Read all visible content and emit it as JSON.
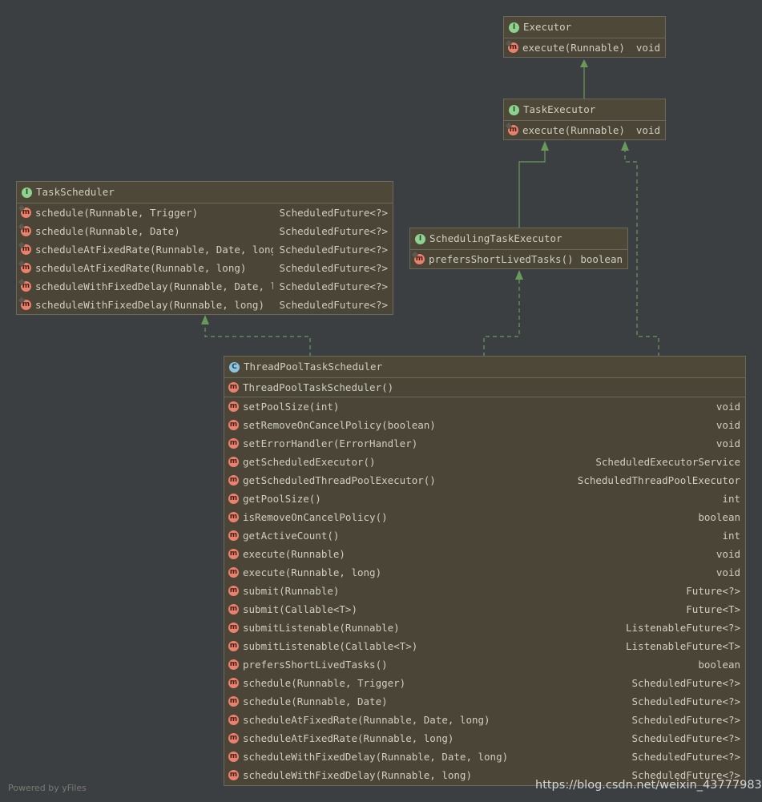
{
  "classes": {
    "executor": {
      "name": "Executor",
      "kind": "I",
      "methods": [
        {
          "name": "execute(Runnable)",
          "ret": "void"
        }
      ]
    },
    "task_executor": {
      "name": "TaskExecutor",
      "kind": "I",
      "methods": [
        {
          "name": "execute(Runnable)",
          "ret": "void"
        }
      ]
    },
    "scheduling_task_executor": {
      "name": "SchedulingTaskExecutor",
      "kind": "I",
      "methods": [
        {
          "name": "prefersShortLivedTasks()",
          "ret": "boolean"
        }
      ]
    },
    "task_scheduler": {
      "name": "TaskScheduler",
      "kind": "I",
      "methods": [
        {
          "name": "schedule(Runnable, Trigger)",
          "ret": "ScheduledFuture<?>"
        },
        {
          "name": "schedule(Runnable, Date)",
          "ret": "ScheduledFuture<?>"
        },
        {
          "name": "scheduleAtFixedRate(Runnable, Date, long)",
          "ret": "ScheduledFuture<?>"
        },
        {
          "name": "scheduleAtFixedRate(Runnable, long)",
          "ret": "ScheduledFuture<?>"
        },
        {
          "name": "scheduleWithFixedDelay(Runnable, Date, long)",
          "ret": "ScheduledFuture<?>"
        },
        {
          "name": "scheduleWithFixedDelay(Runnable, long)",
          "ret": "ScheduledFuture<?>"
        }
      ]
    },
    "thread_pool_task_scheduler": {
      "name": "ThreadPoolTaskScheduler",
      "kind": "C",
      "constructor": "ThreadPoolTaskScheduler()",
      "methods": [
        {
          "name": "setPoolSize(int)",
          "ret": "void"
        },
        {
          "name": "setRemoveOnCancelPolicy(boolean)",
          "ret": "void"
        },
        {
          "name": "setErrorHandler(ErrorHandler)",
          "ret": "void"
        },
        {
          "name": "getScheduledExecutor()",
          "ret": "ScheduledExecutorService"
        },
        {
          "name": "getScheduledThreadPoolExecutor()",
          "ret": "ScheduledThreadPoolExecutor"
        },
        {
          "name": "getPoolSize()",
          "ret": "int"
        },
        {
          "name": "isRemoveOnCancelPolicy()",
          "ret": "boolean"
        },
        {
          "name": "getActiveCount()",
          "ret": "int"
        },
        {
          "name": "execute(Runnable)",
          "ret": "void"
        },
        {
          "name": "execute(Runnable, long)",
          "ret": "void"
        },
        {
          "name": "submit(Runnable)",
          "ret": "Future<?>"
        },
        {
          "name": "submit(Callable<T>)",
          "ret": "Future<T>"
        },
        {
          "name": "submitListenable(Runnable)",
          "ret": "ListenableFuture<?>"
        },
        {
          "name": "submitListenable(Callable<T>)",
          "ret": "ListenableFuture<T>"
        },
        {
          "name": "prefersShortLivedTasks()",
          "ret": "boolean"
        },
        {
          "name": "schedule(Runnable, Trigger)",
          "ret": "ScheduledFuture<?>"
        },
        {
          "name": "schedule(Runnable, Date)",
          "ret": "ScheduledFuture<?>"
        },
        {
          "name": "scheduleAtFixedRate(Runnable, Date, long)",
          "ret": "ScheduledFuture<?>"
        },
        {
          "name": "scheduleAtFixedRate(Runnable, long)",
          "ret": "ScheduledFuture<?>"
        },
        {
          "name": "scheduleWithFixedDelay(Runnable, Date, long)",
          "ret": "ScheduledFuture<?>"
        },
        {
          "name": "scheduleWithFixedDelay(Runnable, long)",
          "ret": "ScheduledFuture<?>"
        }
      ]
    }
  },
  "footer": {
    "powered_by": "Powered by yFiles",
    "watermark": "https://blog.csdn.net/weixin_43777983"
  },
  "colors": {
    "background": "#3c3f41",
    "class_body": "#4a4536",
    "arrow": "#6a9a5a",
    "interface_badge": "#8fd18f",
    "class_badge": "#8fc4e0",
    "method_badge": "#e8826e"
  }
}
